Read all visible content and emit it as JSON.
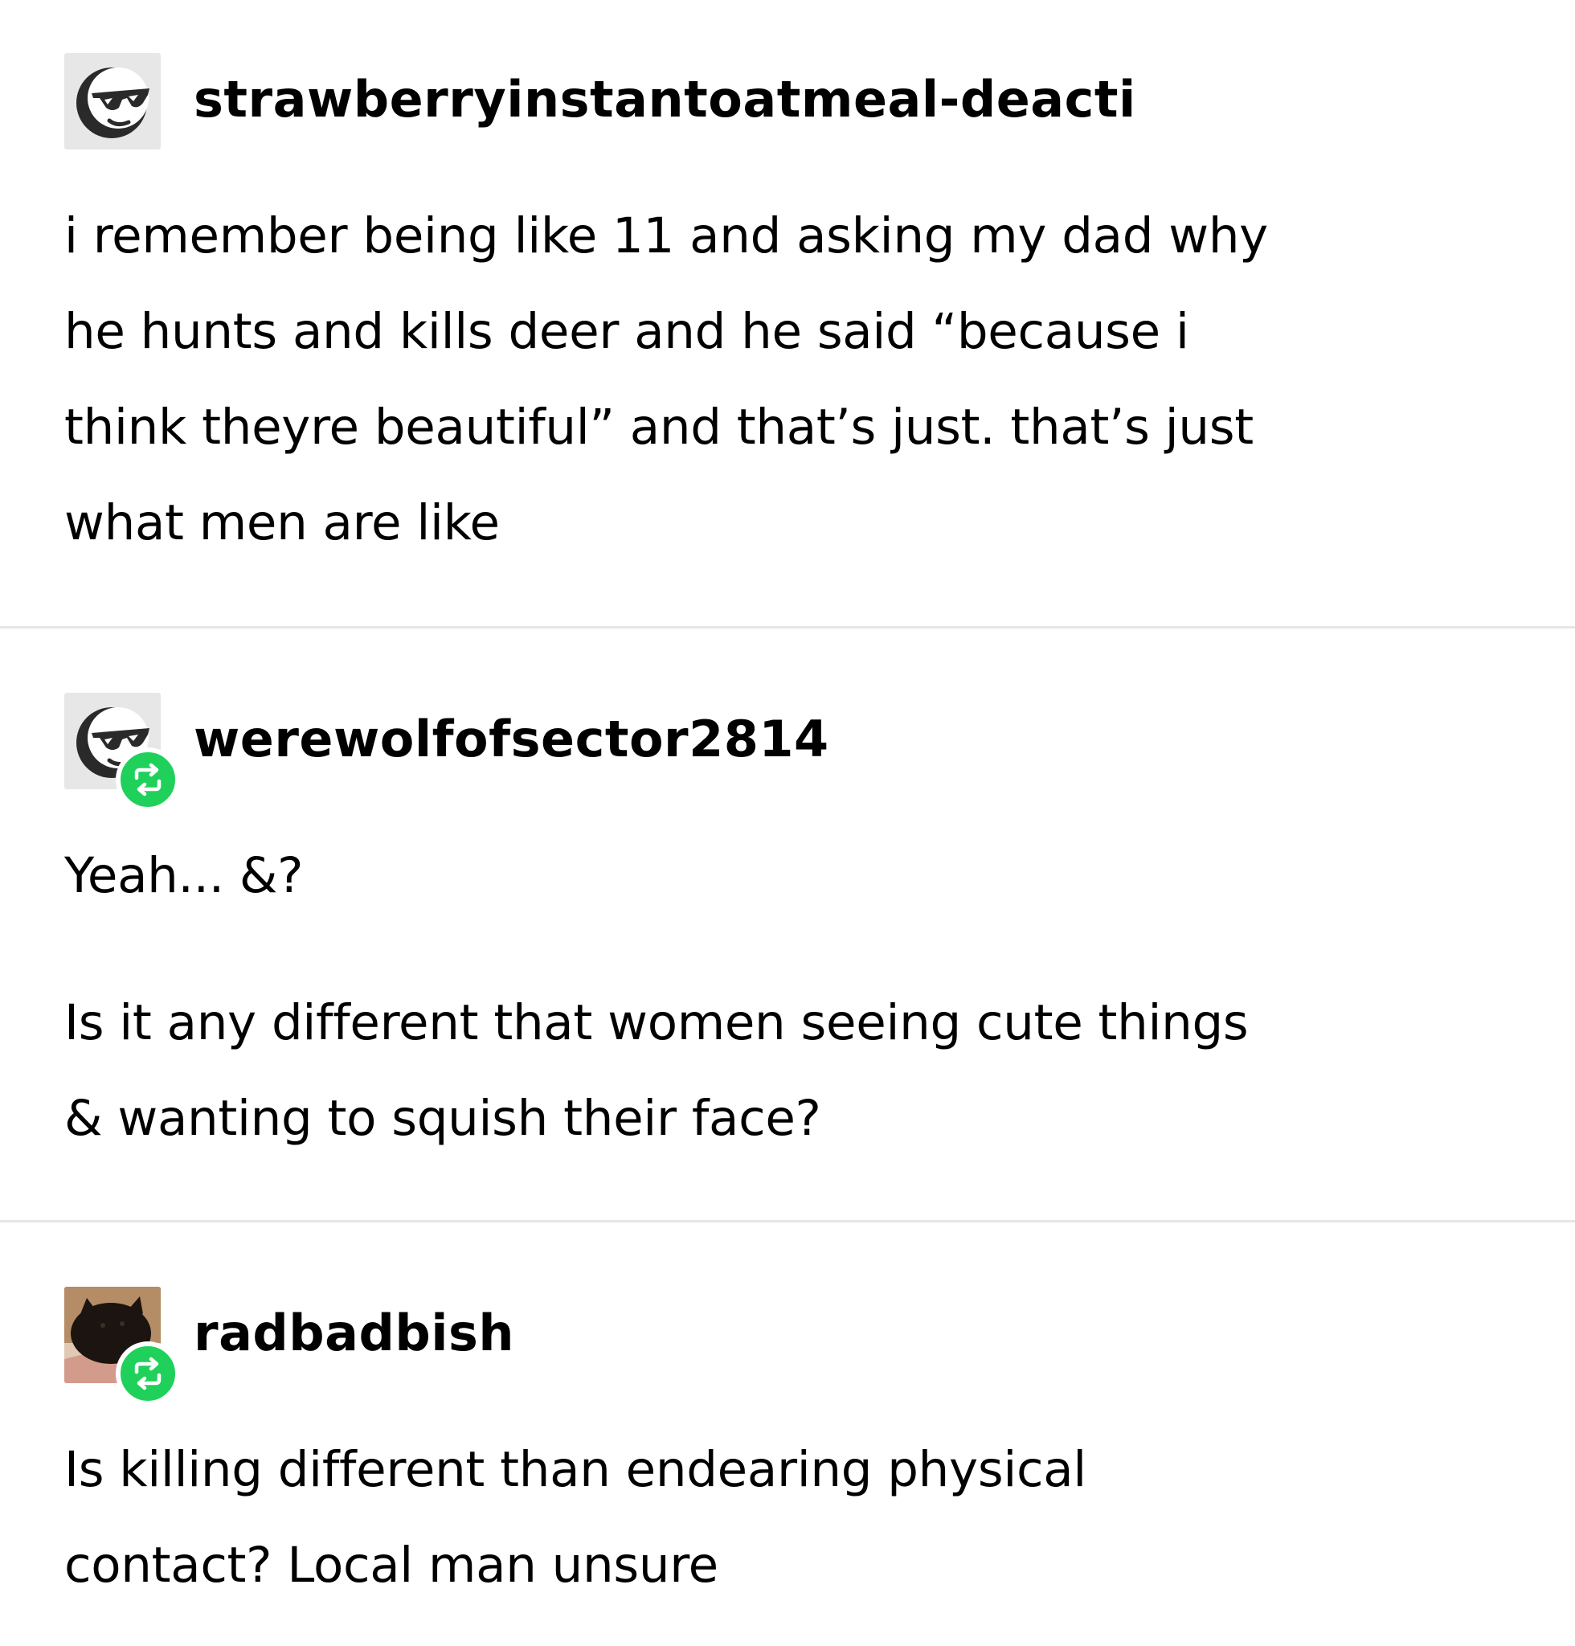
{
  "posts": [
    {
      "username": "strawberryinstantoatmeal-deacti",
      "avatar_icon": "sunglasses-face-icon",
      "reblogged": false,
      "lines": [
        "i remember being like 11 and asking my dad why",
        "he hunts and kills deer and he said “because i",
        "think theyre beautiful” and that’s just. that’s just",
        "what men are like"
      ]
    },
    {
      "username": "werewolfofsector2814",
      "avatar_icon": "sunglasses-face-icon",
      "reblogged": true,
      "paragraph1": "Yeah... &?",
      "paragraph2_lines": [
        "Is it any different that women seeing cute things",
        "& wanting to squish their face?"
      ]
    },
    {
      "username": "radbadbish",
      "avatar_icon": "cat-photo-icon",
      "reblogged": true,
      "lines": [
        "Is killing different than endearing physical",
        "contact? Local man unsure"
      ]
    }
  ],
  "colors": {
    "reblog_badge": "#1fd15a",
    "divider": "#e6e6e6",
    "avatar_bg": "#e7e7e7",
    "text": "#000000"
  }
}
